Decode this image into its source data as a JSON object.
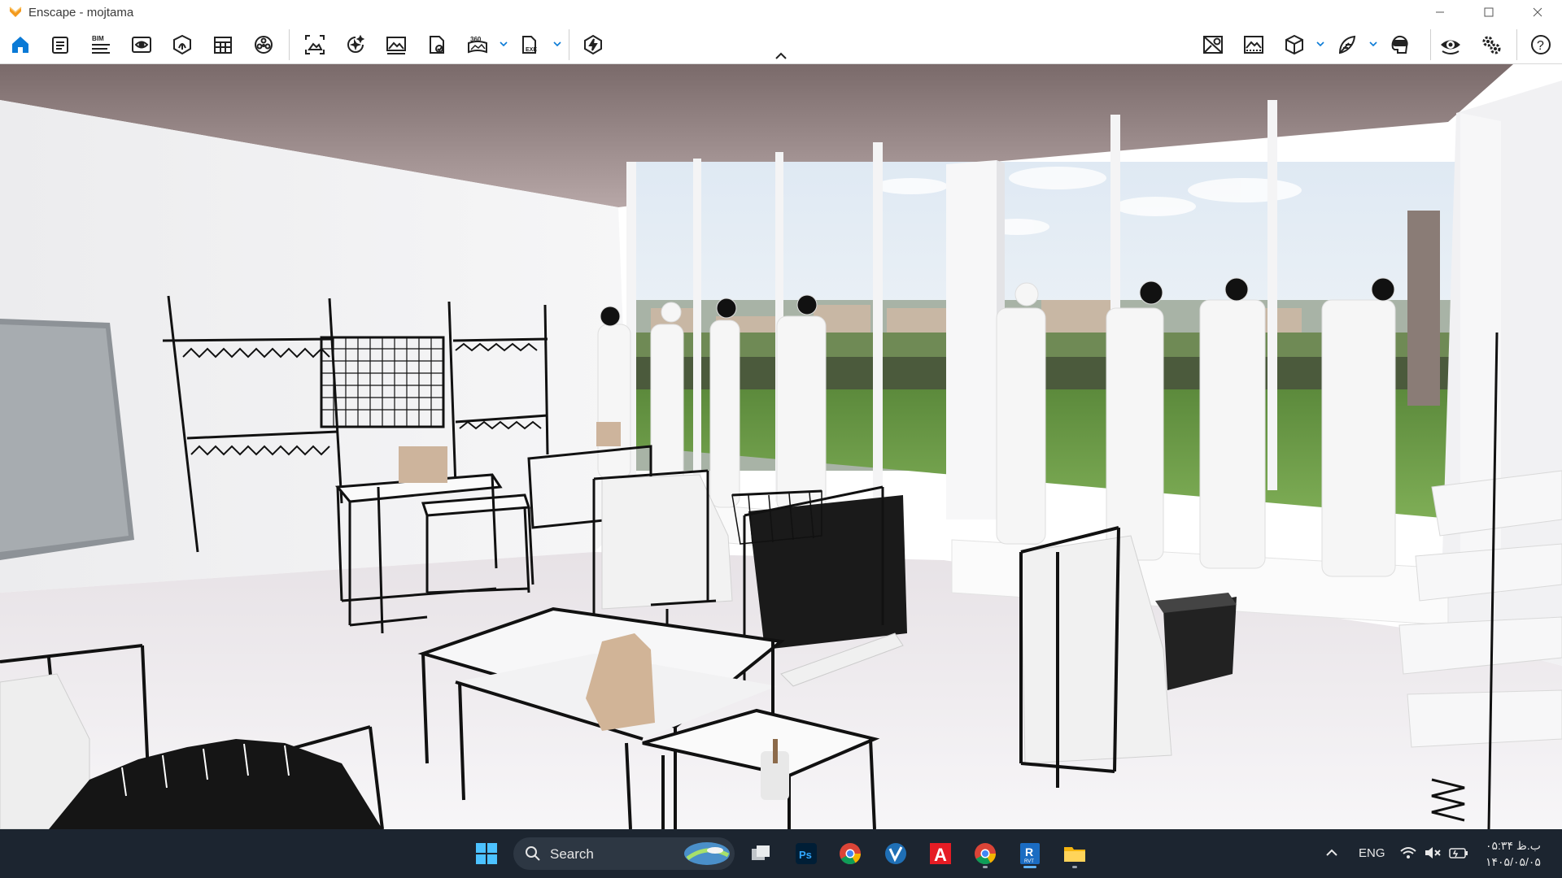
{
  "window": {
    "title": "Enscape - mojtama",
    "controls": [
      "minimize-icon",
      "maximize-icon",
      "close-icon"
    ]
  },
  "toolbar": {
    "left_icons": [
      "home-icon",
      "project-info-icon",
      "bim-icon",
      "views-icon",
      "asset-library-icon",
      "material-editor-icon",
      "site-context-icon",
      "screenshot-icon",
      "render-batch-icon",
      "image-export-icon",
      "web-standalone-icon",
      "panorama-360-icon",
      "exe-export-icon",
      "live-updates-icon"
    ],
    "bim_label": "BIM",
    "pano_label": "360",
    "exe_label": "EXE",
    "right_icons": [
      "map-icon",
      "atmosphere-icon",
      "cube-view-icon",
      "feather-icon",
      "vr-headset-icon",
      "visibility-eye-icon",
      "settings-icon",
      "help-icon"
    ],
    "help_label": "?",
    "collapse_icon": "chevron-up-icon",
    "accent": "#0a7ad6"
  },
  "viewport": {
    "description_kind": "3D render of a retail clothing store interior"
  },
  "taskbar": {
    "search_placeholder": "Search",
    "apps": [
      "windows-start-icon",
      "task-view-icon",
      "photoshop-icon",
      "chrome-icon",
      "vpn-icon",
      "autocad-icon",
      "chrome-profile-icon",
      "revit-icon",
      "file-explorer-icon"
    ],
    "photoshop_label": "Ps",
    "autocad_label": "A",
    "revit_label": "R",
    "revit_sub": "RVT",
    "tray": {
      "language": "ENG",
      "time": "ب.ظ ۰۵:۳۴",
      "date": "۱۴۰۵/۰۵/۰۵"
    }
  }
}
